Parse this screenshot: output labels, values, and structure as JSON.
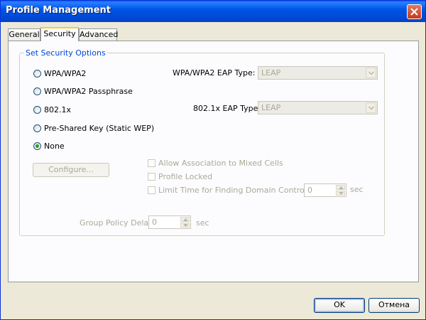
{
  "window": {
    "title": "Profile Management"
  },
  "tabs": [
    {
      "label": "General",
      "active": false
    },
    {
      "label": "Security",
      "active": true
    },
    {
      "label": "Advanced",
      "active": false
    }
  ],
  "group": {
    "title": "Set Security Options"
  },
  "radios": [
    {
      "label": "WPA/WPA2",
      "checked": false
    },
    {
      "label": "WPA/WPA2 Passphrase",
      "checked": false
    },
    {
      "label": "802.1x",
      "checked": false
    },
    {
      "label": "Pre-Shared Key (Static WEP)",
      "checked": false
    },
    {
      "label": "None",
      "checked": true
    }
  ],
  "eap": {
    "wpa_label": "WPA/WPA2 EAP Type:",
    "wpa_value": "LEAP",
    "x_label": "802.1x EAP Type:",
    "x_value": "LEAP"
  },
  "configure_label": "Configure...",
  "checkboxes": [
    {
      "label": "Allow Association to Mixed Cells"
    },
    {
      "label": "Profile Locked"
    },
    {
      "label": "Limit Time for Finding Domain Controller To:"
    }
  ],
  "domain_timeout": {
    "value": "0",
    "unit": "sec"
  },
  "group_policy": {
    "label": "Group Policy Delay:",
    "value": "0",
    "unit": "sec"
  },
  "footer": {
    "ok_label": "OK",
    "cancel_label": "Отмена"
  },
  "colors": {
    "title_bar": "#0055e5",
    "group_title": "#0046d5",
    "disabled_text": "#aca899",
    "active_tab_accent": "#ffc83c"
  }
}
